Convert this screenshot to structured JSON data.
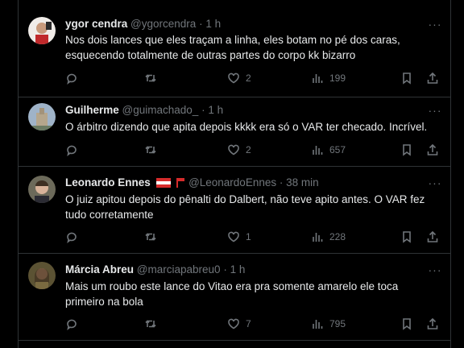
{
  "tweets": [
    {
      "name": "ygor cendra",
      "handle": "@ygorcendra",
      "dot": "·",
      "time": "1 h",
      "text_lines": [
        "Nos dois lances que eles traçam a linha,  eles botam no pé dos caras,",
        "esquecendo totalmente de outras partes do corpo kk bizarro"
      ],
      "replies": "",
      "retweets": "",
      "likes": "2",
      "views": "199"
    },
    {
      "name": "Guilherme",
      "handle": "@guimachado_",
      "dot": "·",
      "time": "1 h",
      "text_lines": [
        "O árbitro dizendo que apita depois kkkk era só o VAR ter checado. Incrível."
      ],
      "replies": "",
      "retweets": "",
      "likes": "2",
      "views": "657"
    },
    {
      "name": "Leonardo Ennes",
      "handle": "@LeonardoEnnes",
      "dot": "·",
      "time": "38 min",
      "text_lines": [
        "O juiz apitou depois do pênalti do Dalbert, não teve apito antes. O VAR fez",
        "tudo corretamente"
      ],
      "replies": "",
      "retweets": "",
      "likes": "1",
      "views": "228"
    },
    {
      "name": "Márcia Abreu",
      "handle": "@marciapabreu0",
      "dot": "·",
      "time": "1 h",
      "text_lines": [
        "Mais um roubo este lance do Vitao era pra somente amarelo ele toca",
        "primeiro na bola"
      ],
      "replies": "",
      "retweets": "",
      "likes": "7",
      "views": "795"
    }
  ],
  "icons": {
    "reply": "reply-icon",
    "retweet": "retweet-icon",
    "like": "heart-icon",
    "views": "views-chart-icon",
    "bookmark": "bookmark-icon",
    "share": "share-icon",
    "more": "more-icon"
  },
  "more_label": "···",
  "colors": {
    "background": "#000000",
    "text": "#e7e9ea",
    "muted": "#71767b",
    "divider": "#2f3336",
    "flag_red": "#d62b2b"
  }
}
